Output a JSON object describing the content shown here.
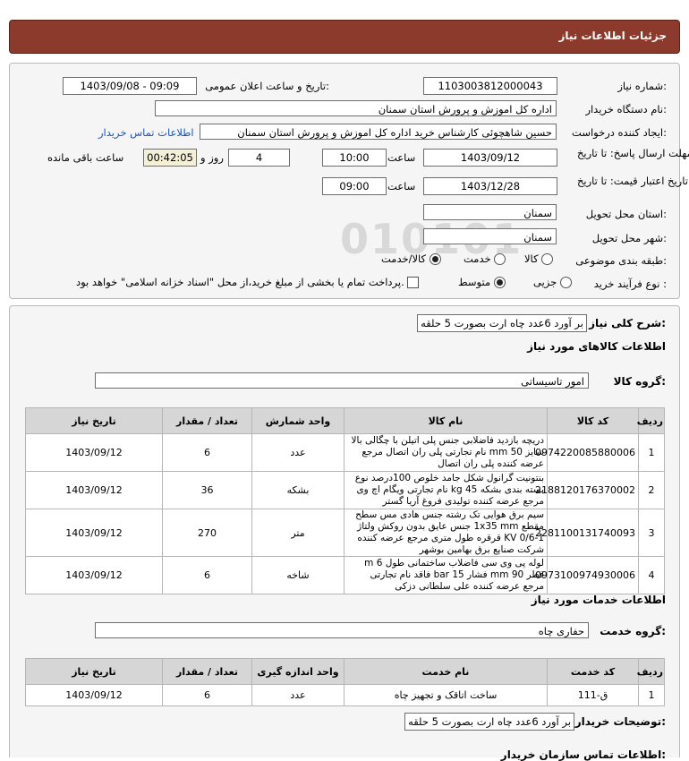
{
  "header": {
    "title": "جزئیات اطلاعات نیاز"
  },
  "need": {
    "number_label": "شماره نیاز:",
    "number": "1103003812000043",
    "announce_label": "تاریخ و ساعت اعلان عمومی:",
    "announce_value": "1403/09/08 - 09:09",
    "buyer_label": "نام دستگاه خریدار:",
    "buyer": "اداره کل اموزش و پرورش استان سمنان",
    "requester_label": "ایجاد کننده درخواست:",
    "requester": "حسین شاهچوئی کارشناس خرید اداره کل اموزش و پرورش استان سمنان",
    "contact_link": "اطلاعات تماس خریدار",
    "deadline_label": "مهلت ارسال پاسخ: تا تاریخ:",
    "deadline_date": "1403/09/12",
    "time_label": "ساعت",
    "deadline_time": "10:00",
    "days": "4",
    "days_label": "روز و",
    "remaining": "00:42:05",
    "remaining_label": "ساعت باقی مانده",
    "validity_label": "حداقل تاریخ اعتبار قیمت: تا تاریخ:",
    "validity_date": "1403/12/28",
    "validity_time": "09:00",
    "province_label": "استان محل تحویل:",
    "province": "سمنان",
    "city_label": "شهر محل تحویل:",
    "city": "سمنان",
    "category_label": "طبقه بندی موضوعی:",
    "category_options": [
      "کالا",
      "خدمت",
      "کالا/خدمت"
    ],
    "process_label": "نوع فرآیند خرید :",
    "process_options": [
      "جزیی",
      "متوسط"
    ],
    "payment_note": "پرداخت تمام یا بخشی از مبلغ خرید،از محل \"اسناد خزانه اسلامی\" خواهد بود."
  },
  "summary": {
    "label": "شرح کلی نیاز:",
    "value": "بر آورد 6عدد چاه ارت بصورت 5 حلقه",
    "goods_heading": "اطلاعات کالاهای مورد نیاز",
    "group_label": "گروه کالا:",
    "group_value": "امور تاسیساتی"
  },
  "goods_table": {
    "headers": [
      "ردیف",
      "کد کالا",
      "نام کالا",
      "واحد شمارش",
      "تعداد / مقدار",
      "تاریخ نیاز"
    ],
    "rows": [
      [
        "1",
        "0974220085880006",
        "دریچه بازدید فاضلابی جنس پلی اتیلن با چگالی بالا سایز 50 mm نام تجارتی پلی ران اتصال مرجع عرضه کننده پلی ران اتصال",
        "عدد",
        "6",
        "1403/09/12"
      ],
      [
        "2",
        "2188120176370002",
        "بنتونیت گرانول شکل جامد خلوص 100درصد نوع بسته بندی بشکه 45 kg نام تجارتی ویگام اچ وی مرجع عرضه کننده تولیدی فروغ آریا گستر",
        "بشکه",
        "36",
        "1403/09/12"
      ],
      [
        "3",
        "2281100131740093",
        "سیم برق هوایی تک رشته جنس هادی مس سطح مقطع 1x35 mm جنس عایق بدون روکش ولتاژ 1-0/6 KV قرقره طول متری مرجع عرضه کننده شرکت صنایع برق بهامین بوشهر",
        "متر",
        "270",
        "1403/09/12"
      ],
      [
        "4",
        "0973100974930006",
        "لوله پی وی سی فاضلاب ساختمانی طول 6 m قطر 90 mm فشار 15 bar فاقد نام تجارتی مرجع عرضه کننده علی سلطانی دزکی",
        "شاخه",
        "6",
        "1403/09/12"
      ]
    ]
  },
  "services": {
    "heading": "اطلاعات خدمات مورد نیاز",
    "group_label": "گروه خدمت:",
    "group_value": "حفاری چاه",
    "headers": [
      "ردیف",
      "کد خدمت",
      "نام خدمت",
      "واحد اندازه گیری",
      "تعداد / مقدار",
      "تاریخ نیاز"
    ],
    "rows": [
      [
        "1",
        "ق-111",
        "ساخت اتاقک و تجهیز چاه",
        "عدد",
        "6",
        "1403/09/12"
      ]
    ]
  },
  "buyer_notes": {
    "label": "توضیحات خریدار:",
    "value": "بر آورد 6عدد چاه ارت بصورت 5 حلقه",
    "next_heading": "اطلاعات تماس سازمان خریدار:"
  },
  "watermark": {
    "digits": "010101",
    "brand": "ParsNamadData",
    "line1": "مرجع اطلاعات مناقصه و مزایده",
    "line2": "۰۲۱ - ۸۸۳۴۹۶۷۰"
  }
}
